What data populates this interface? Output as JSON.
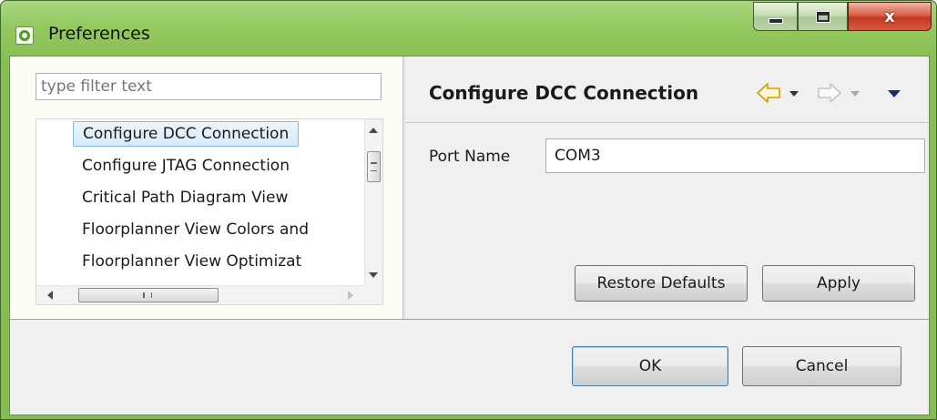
{
  "window": {
    "title": "Preferences",
    "icon": "preferences-app-icon",
    "controls": {
      "minimize": "minimize-icon",
      "maximize": "maximize-icon",
      "close_glyph": "x"
    }
  },
  "filter": {
    "placeholder": "type filter text",
    "value": ""
  },
  "tree": {
    "items": [
      {
        "label": "Configure DCC Connection",
        "selected": true
      },
      {
        "label": "Configure JTAG Connection",
        "selected": false
      },
      {
        "label": "Critical Path Diagram View",
        "selected": false
      },
      {
        "label": "Floorplanner View Colors and",
        "selected": false
      },
      {
        "label": "Floorplanner View Optimizat",
        "selected": false
      }
    ],
    "scroll_h_glyph": "III"
  },
  "page": {
    "title": "Configure DCC Connection",
    "nav": {
      "back_icon": "back-arrow-icon",
      "forward_icon": "forward-arrow-icon",
      "menu_icon": "view-menu-icon"
    },
    "port_name": {
      "label": "Port Name",
      "value": "COM3"
    },
    "restore_defaults_label": "Restore Defaults",
    "apply_label": "Apply"
  },
  "dialog": {
    "ok_label": "OK",
    "cancel_label": "Cancel"
  },
  "colors": {
    "title_bar": "#93c85f",
    "selection_border": "#86b7e0",
    "close_button": "#c2381f",
    "default_button_border": "#3c7fb1"
  }
}
